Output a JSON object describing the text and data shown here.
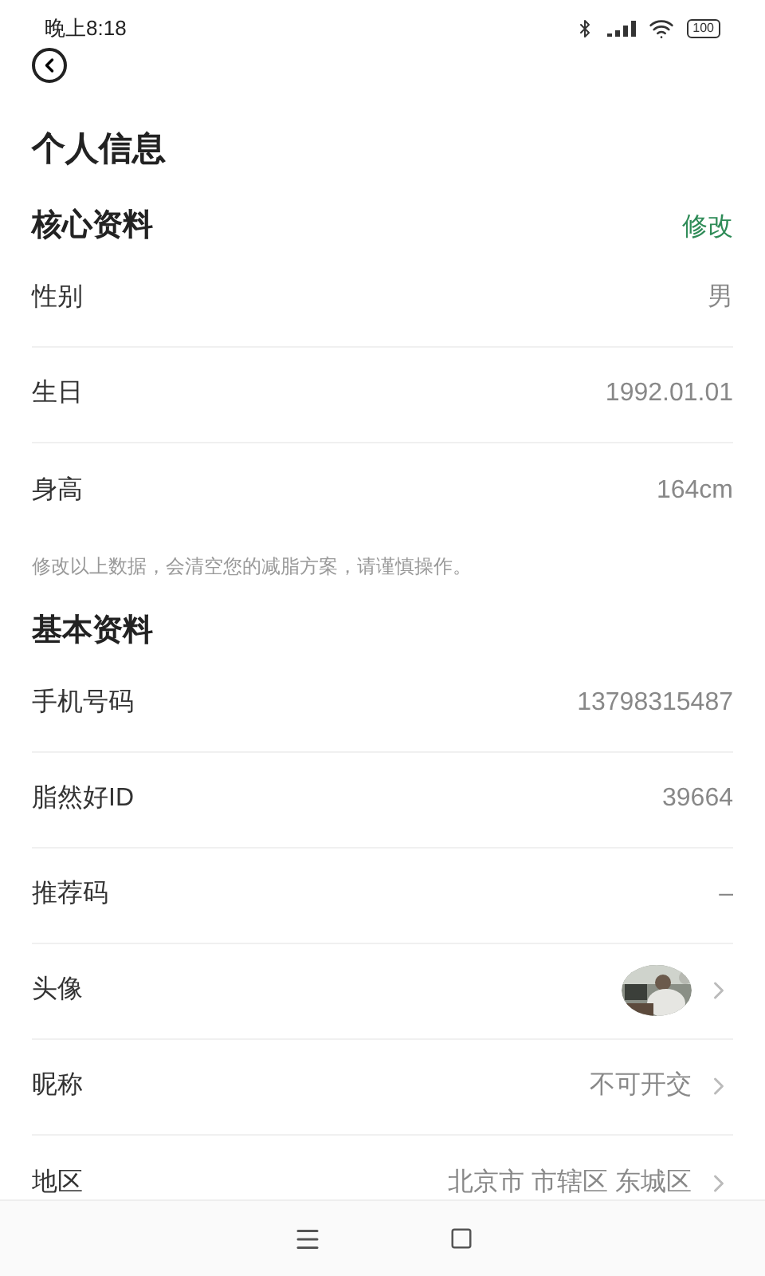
{
  "status_bar": {
    "time": "晚上8:18",
    "battery": "100"
  },
  "title": "个人信息",
  "sections": [
    {
      "title": "核心资料",
      "action": "修改",
      "note": "修改以上数据，会清空您的减脂方案，请谨慎操作。",
      "rows": [
        {
          "kind": "text",
          "label": "性别",
          "value": "男",
          "chevron": false
        },
        {
          "kind": "text",
          "label": "生日",
          "value": "1992.01.01",
          "chevron": false
        },
        {
          "kind": "text",
          "label": "身高",
          "value": "164cm",
          "chevron": false
        }
      ]
    },
    {
      "title": "基本资料",
      "rows": [
        {
          "kind": "text",
          "label": "手机号码",
          "value": "13798315487",
          "chevron": false
        },
        {
          "kind": "text",
          "label": "脂然好ID",
          "value": "39664",
          "chevron": false
        },
        {
          "kind": "text",
          "label": "推荐码",
          "value": "–",
          "chevron": false
        },
        {
          "kind": "picture",
          "label": "头像",
          "chevron": true
        },
        {
          "kind": "text",
          "label": "昵称",
          "value": "不可开交",
          "chevron": true
        },
        {
          "kind": "text",
          "label": "地区",
          "value": "北京市 市辖区 东城区",
          "chevron": true
        }
      ]
    }
  ]
}
